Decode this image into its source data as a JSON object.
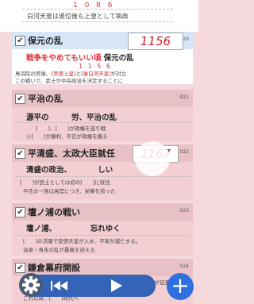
{
  "top": {
    "year": "1 0 8 6",
    "note": "白河天皇は退位後も上皇として執政"
  },
  "cards": [
    {
      "title": "保元の乱",
      "num": "020",
      "year": "1156",
      "line1_a": "戦争をやめてもいい頃",
      "line1_b": " 保元の乱",
      "small_year": "1 1 5 6",
      "note1": "鳥羽院の死後、",
      "tag1": "[崇徳上皇]",
      "note1b": "と",
      "tag2": "[後白河天皇]",
      "note1c": "が対立",
      "note2": "この戦いで、武士が中央政治を決定することに"
    },
    {
      "title": "平治の乱",
      "num": "021",
      "line1": "源平の　　　労、平治の乱",
      "note1": "[　　]、[　　]が政権を巡り戦",
      "note2": "い[　　]が勝利、平氏が政権を握る"
    },
    {
      "title": "平清盛、太政大臣就任",
      "num": "022",
      "year": "1167",
      "line1": "清盛の政治、　　　　しい",
      "note1": "[　　]が武士としては初の[　　]に就任",
      "note2": "平氏の一族は高官につき、栄華を誇った"
    },
    {
      "title": "壇ノ浦の戦い",
      "num": "023",
      "line1": "壇ノ浦、　　　　　忘れゆく",
      "note1": "[　　]の活躍で安徳天皇が入水、平家が滅亡する。",
      "note2": "治承・寿永の乱が最後を迎える"
    },
    {
      "title": "鎌倉幕府開設",
      "num": "024",
      "note1": "源頼朝が征夷大将軍に",
      "note2": "これ以降、[　　]時代へ"
    }
  ],
  "controls": {
    "add_label": "+"
  }
}
